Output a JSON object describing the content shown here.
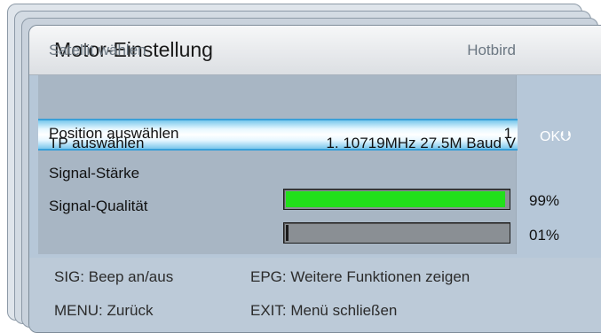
{
  "window": {
    "title": "Motor-Einstellung"
  },
  "rows": {
    "satellite": {
      "label": "Satellit wählen",
      "value": "Hotbird"
    },
    "position": {
      "label": "Position auswählen",
      "value": "1"
    },
    "tp": {
      "label": "TP auswählen",
      "value": "1. 10719MHz 27.5M Baud V"
    },
    "signal_strength": {
      "label": "Signal-Stärke",
      "percent_text": "99%",
      "level": 99
    },
    "signal_quality": {
      "label": "Signal-Qualität",
      "percent_text": "01%",
      "level": 1
    }
  },
  "ok_indicator": {
    "label": "OK",
    "icon": "down-arrow-icon"
  },
  "footer": {
    "sig": "SIG: Beep an/aus",
    "epg": "EPG: Weitere Funktionen zeigen",
    "menu": "MENU: Zurück",
    "exit": "EXIT: Menü schließen"
  },
  "colors": {
    "highlight": "#79c7ec",
    "signal_fill": "#22e01a",
    "panel": "#a8b6c4"
  }
}
